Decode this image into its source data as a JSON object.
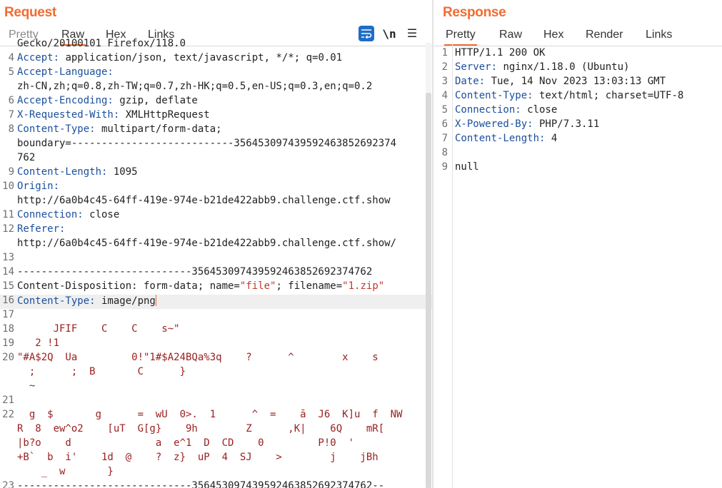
{
  "request": {
    "title": "Request",
    "tabs": [
      "Pretty",
      "Raw",
      "Hex",
      "Links"
    ],
    "active_tab": "Raw",
    "tools": {
      "wrap": "wrap-lines-icon",
      "newline": "\\n",
      "menu": "☰"
    },
    "lines": [
      {
        "n": "",
        "text": "Gecko/20100101 Firefox/118.0"
      },
      {
        "n": "4",
        "name": "Accept:",
        "value": " application/json, text/javascript, */*; q=0.01"
      },
      {
        "n": "5",
        "name": "Accept-Language:",
        "value": ""
      },
      {
        "n": "",
        "text": "zh-CN,zh;q=0.8,zh-TW;q=0.7,zh-HK;q=0.5,en-US;q=0.3,en;q=0.2"
      },
      {
        "n": "6",
        "name": "Accept-Encoding:",
        "value": " gzip, deflate"
      },
      {
        "n": "7",
        "name": "X-Requested-With:",
        "value": " XMLHttpRequest"
      },
      {
        "n": "8",
        "name": "Content-Type:",
        "value": " multipart/form-data;"
      },
      {
        "n": "",
        "text": "boundary=---------------------------356453097439592463852692374"
      },
      {
        "n": "",
        "text": "762"
      },
      {
        "n": "9",
        "name": "Content-Length:",
        "value": " 1095"
      },
      {
        "n": "10",
        "name": "Origin:",
        "value": ""
      },
      {
        "n": "",
        "text": "http://6a0b4c45-64ff-419e-974e-b21de422abb9.challenge.ctf.show"
      },
      {
        "n": "11",
        "name": "Connection:",
        "value": " close"
      },
      {
        "n": "12",
        "name": "Referer:",
        "value": ""
      },
      {
        "n": "",
        "text": "http://6a0b4c45-64ff-419e-974e-b21de422abb9.challenge.ctf.show/"
      },
      {
        "n": "13",
        "text": ""
      },
      {
        "n": "14",
        "text": "-----------------------------356453097439592463852692374762"
      },
      {
        "n": "15",
        "cd": true,
        "pre": "Content-Disposition: form-data; name=",
        "q1": "\"file\"",
        "mid": "; filename=",
        "q2": "\"1.zip\""
      },
      {
        "n": "16",
        "name": "Content-Type:",
        "value": " image/png",
        "highlight": true,
        "cursor": true
      },
      {
        "n": "17",
        "text": ""
      },
      {
        "n": "18",
        "bin": true,
        "text": "      JFIF    C    C    s~\""
      },
      {
        "n": "19",
        "bin": true,
        "text": "   2 !1"
      },
      {
        "n": "20",
        "bin": true,
        "text": "\"#A$2Q  Ua         0!\"1#$A24BQa%3q    ?      ^        x    s"
      },
      {
        "n": "",
        "bin": true,
        "text": "  ;      ;  B       C      }"
      },
      {
        "n": "",
        "bin": true,
        "text": "  ~"
      },
      {
        "n": "21",
        "text": ""
      },
      {
        "n": "22",
        "bin": true,
        "text": "  g  $       g      =  wU  0>.  1      ^  =    ā  J6  K]u  f  NW"
      },
      {
        "n": "",
        "bin": true,
        "text": "R  8  ew^o2    [uT  G[g}    9h        Z      ,K|    6Q    mR["
      },
      {
        "n": "",
        "bin": true,
        "text": "|b?o    d              a  e^1  D  CD    0         P!0  '"
      },
      {
        "n": "",
        "bin": true,
        "text": "+B`  b  i'    1d  @    ?  z}  uP  4  SJ    >        j    jBh"
      },
      {
        "n": "",
        "bin": true,
        "text": "    _  w       }"
      },
      {
        "n": "23",
        "text": "-----------------------------356453097439592463852692374762--"
      },
      {
        "n": "24",
        "text": ""
      }
    ]
  },
  "response": {
    "title": "Response",
    "tabs": [
      "Pretty",
      "Raw",
      "Hex",
      "Render",
      "Links"
    ],
    "active_tab": "Pretty",
    "lines": [
      {
        "n": "1",
        "text": "HTTP/1.1 200 OK"
      },
      {
        "n": "2",
        "name": "Server:",
        "value": " nginx/1.18.0 (Ubuntu)"
      },
      {
        "n": "3",
        "name": "Date:",
        "value": " Tue, 14 Nov 2023 13:03:13 GMT"
      },
      {
        "n": "4",
        "name": "Content-Type:",
        "value": " text/html; charset=UTF-8"
      },
      {
        "n": "5",
        "name": "Connection:",
        "value": " close"
      },
      {
        "n": "6",
        "name": "X-Powered-By:",
        "value": " PHP/7.3.11"
      },
      {
        "n": "7",
        "name": "Content-Length:",
        "value": " 4"
      },
      {
        "n": "8",
        "text": ""
      },
      {
        "n": "9",
        "text": "null"
      }
    ]
  },
  "colors": {
    "accent": "#f26b32",
    "header_name": "#1b4f9c",
    "quoted": "#c0392b",
    "binary": "#9a2020",
    "wrap_button": "#1e6dc7"
  }
}
